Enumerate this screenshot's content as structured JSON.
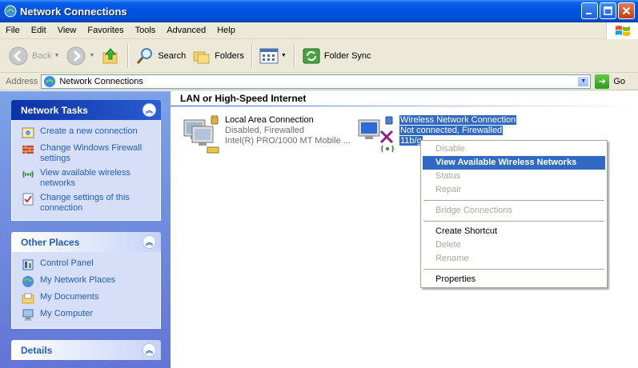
{
  "window": {
    "title": "Network Connections"
  },
  "menubar": [
    "File",
    "Edit",
    "View",
    "Favorites",
    "Tools",
    "Advanced",
    "Help"
  ],
  "toolbar": {
    "back_label": "Back",
    "search_label": "Search",
    "folders_label": "Folders",
    "folder_sync_label": "Folder Sync"
  },
  "address": {
    "label": "Address",
    "value": "Network Connections",
    "go_label": "Go"
  },
  "panels": {
    "network_tasks": {
      "title": "Network Tasks",
      "items": [
        "Create a new connection",
        "Change Windows Firewall settings",
        "View available wireless networks",
        "Change settings of this connection"
      ]
    },
    "other_places": {
      "title": "Other Places",
      "items": [
        "Control Panel",
        "My Network Places",
        "My Documents",
        "My Computer"
      ]
    },
    "details": {
      "title": "Details"
    }
  },
  "content": {
    "group_header": "LAN or High-Speed Internet",
    "connections": [
      {
        "name": "Local Area Connection",
        "status": "Disabled, Firewalled",
        "device": "Intel(R) PRO/1000 MT Mobile ..."
      },
      {
        "name": "Wireless Network Connection",
        "status": "Not connected, Firewalled",
        "device": "11b/g"
      }
    ]
  },
  "context_menu": {
    "items": [
      {
        "label": "Disable",
        "state": "disabled"
      },
      {
        "label": "View Available Wireless Networks",
        "state": "highlighted"
      },
      {
        "label": "Status",
        "state": "disabled"
      },
      {
        "label": "Repair",
        "state": "disabled"
      },
      {
        "label": "Bridge Connections",
        "state": "disabled"
      },
      {
        "label": "Create Shortcut",
        "state": "enabled"
      },
      {
        "label": "Delete",
        "state": "disabled"
      },
      {
        "label": "Rename",
        "state": "disabled"
      },
      {
        "label": "Properties",
        "state": "enabled"
      }
    ]
  },
  "colors": {
    "titlebar": "#0054e3",
    "task_pane": "#6d8ce0",
    "link": "#215dc6",
    "selection": "#316ac5"
  }
}
